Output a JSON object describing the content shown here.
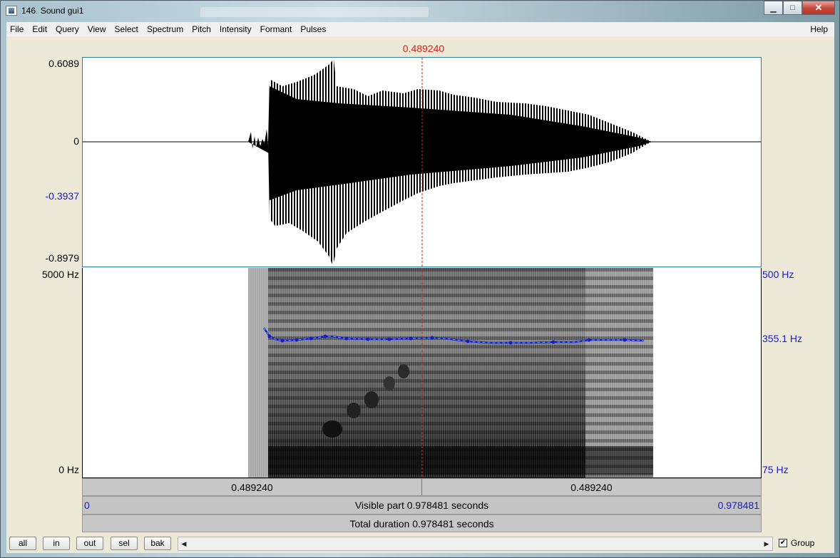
{
  "window": {
    "title": "146. Sound gui1",
    "minimize": "▁",
    "maximize": "□",
    "close": "✕"
  },
  "menu": [
    "File",
    "Edit",
    "Query",
    "View",
    "Select",
    "Spectrum",
    "Pitch",
    "Intensity",
    "Formant",
    "Pulses"
  ],
  "help": "Help",
  "cursor_time": "0.489240",
  "waveform": {
    "y_max": "0.6089",
    "y_zero": "0",
    "y_cursor": "-0.3937",
    "y_min": "-0.8979"
  },
  "spectrogram": {
    "freq_max": "5000 Hz",
    "freq_min": "0 Hz",
    "pitch_max": "500 Hz",
    "pitch_value": "355.1 Hz",
    "pitch_min": "75 Hz"
  },
  "time_bar": {
    "left": "0.489240",
    "right": "0.489240"
  },
  "visible_bar": {
    "start": "0",
    "label": "Visible part 0.978481 seconds",
    "end": "0.978481"
  },
  "total_bar": {
    "label": "Total duration 0.978481 seconds"
  },
  "buttons": {
    "all": "all",
    "in": "in",
    "out": "out",
    "sel": "sel",
    "bak": "bak"
  },
  "scroll_left": "◀",
  "scroll_right": "▶",
  "group": {
    "label": "Group",
    "checked": "✔"
  },
  "colors": {
    "cursor": "#d0241c",
    "pitch": "#1a1acc"
  }
}
